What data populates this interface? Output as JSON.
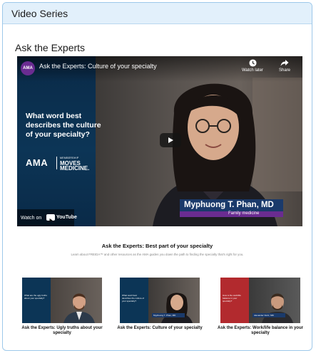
{
  "panel": {
    "title": "Video Series"
  },
  "section": {
    "title": "Ask the Experts"
  },
  "video": {
    "channel_badge": "AMA",
    "title": "Ask the Experts: Culture of your specialty",
    "watch_later_label": "Watch later",
    "share_label": "Share",
    "question": "What word best describes the culture of your specialty?",
    "logo_text": "AMA",
    "moves_line1": "MEMBERSHIP",
    "moves_line2": "MOVES",
    "moves_line3": "MEDICINE.",
    "person_name": "Myphuong T. Phan, MD",
    "person_role": "Family medicine",
    "watch_on_label": "Watch on",
    "youtube_label": "YouTube"
  },
  "description": {
    "title": "Ask the Experts: Best part of your specialty",
    "text": "Learn about FREIDA™ and other resources as the AMA guides you down the path to finding the specialty that's right for you."
  },
  "thumbnails": [
    {
      "caption": "Ask the Experts: Ugly truths about your specialty",
      "question": "What are the ugly truths about your specialty?",
      "name": "",
      "left_color": "#0c3556"
    },
    {
      "caption": "Ask the Experts: Culture of your specialty",
      "question": "What word best describes the culture of your specialty?",
      "name": "Myphuong T. Phan, MD",
      "left_color": "#0c3556"
    },
    {
      "caption": "Ask the Experts: Work/life balance in your specialty",
      "question": "How is the work/life balance in your specialty?",
      "name": "Alexander Nurtz, MD",
      "left_color": "#b22a2e"
    }
  ],
  "colors": {
    "header_bg": "#e2f0fb",
    "border": "#9dc8ea",
    "ama_purple": "#6a2c91",
    "nameplate_blue": "#1a3a6b"
  }
}
